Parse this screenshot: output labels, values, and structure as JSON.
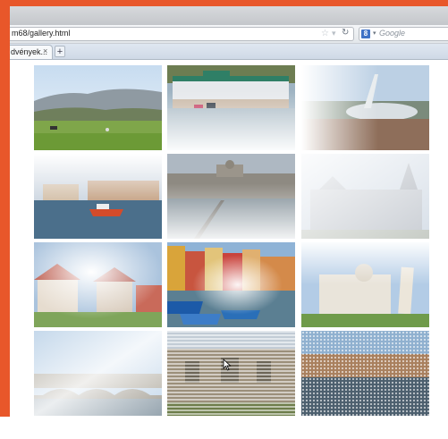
{
  "browser": {
    "url": "m68/gallery.html",
    "search_placeholder": "Google",
    "search_engine_letter": "8",
    "tab_title": "dvények...",
    "tab_close": "×",
    "new_tab": "+"
  },
  "gallery": {
    "tiles": [
      {
        "subject": "hills-meadow",
        "effect": "none"
      },
      {
        "subject": "lakeside-pavilion",
        "effect": "fade-bottom"
      },
      {
        "subject": "stadium-tower",
        "effect": "fade-left"
      },
      {
        "subject": "harbor-boats",
        "effect": "fade-top"
      },
      {
        "subject": "city-bridge",
        "effect": "fade-bottom"
      },
      {
        "subject": "chateau",
        "effect": "fade-strong"
      },
      {
        "subject": "village-houses",
        "effect": "radial-glow"
      },
      {
        "subject": "colorful-harbor",
        "effect": "radial-glow"
      },
      {
        "subject": "pisa-cathedral",
        "effect": "fade-top"
      },
      {
        "subject": "river-bridge",
        "effect": "fade-diagonal"
      },
      {
        "subject": "stone-facade",
        "effect": "scanlines"
      },
      {
        "subject": "waterfront-town",
        "effect": "halftone"
      }
    ]
  }
}
